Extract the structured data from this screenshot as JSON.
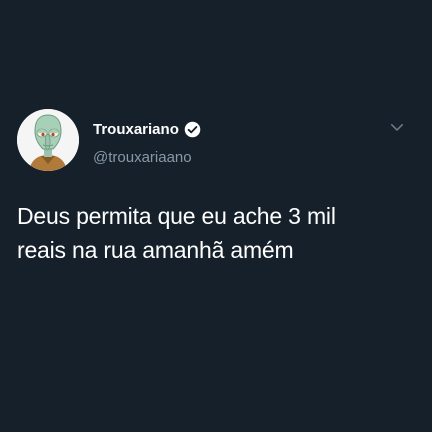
{
  "tweet": {
    "author": {
      "display_name": "Trouxariano",
      "handle": "@trouxariaano",
      "avatar_icon": "squidward-avatar",
      "verified": true,
      "verified_icon": "verified-badge-icon"
    },
    "text_lines": [
      "Deus permita que eu ache 3 mil",
      "reais na rua amanhã amém"
    ],
    "menu_icon": "chevron-down-icon"
  },
  "colors": {
    "background": "#15202b",
    "text_primary": "#ffffff",
    "text_secondary": "#8899a6",
    "chevron": "#6e7f8d"
  }
}
